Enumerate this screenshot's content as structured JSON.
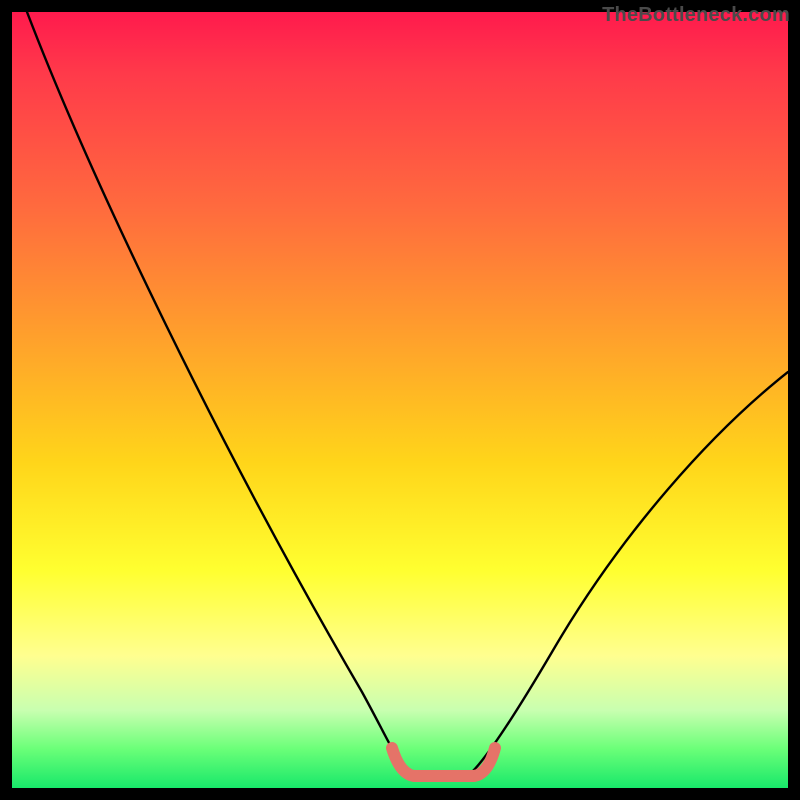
{
  "watermark": {
    "text": "TheBottleneck.com"
  },
  "chart_data": {
    "type": "line",
    "title": "",
    "xlabel": "",
    "ylabel": "",
    "x_range": [
      0,
      100
    ],
    "y_range": [
      0,
      100
    ],
    "grid": false,
    "legend": false,
    "background_gradient": {
      "direction": "vertical",
      "stops": [
        {
          "pos": 0.0,
          "color": "#ff1a4d"
        },
        {
          "pos": 0.25,
          "color": "#ff6a3e"
        },
        {
          "pos": 0.58,
          "color": "#ffd51a"
        },
        {
          "pos": 0.83,
          "color": "#ffff90"
        },
        {
          "pos": 1.0,
          "color": "#18e86a"
        }
      ]
    },
    "series": [
      {
        "name": "bottleneck-curve",
        "color": "#000000",
        "x": [
          2,
          10,
          20,
          30,
          40,
          46,
          50,
          54,
          58,
          62,
          70,
          80,
          90,
          100
        ],
        "y": [
          100,
          82,
          62,
          43,
          25,
          12,
          4,
          0,
          0,
          4,
          16,
          32,
          48,
          58
        ]
      }
    ],
    "annotations": [
      {
        "name": "optimal-range-marker",
        "type": "segment",
        "color": "#e57368",
        "points": [
          {
            "x": 48,
            "y": 4
          },
          {
            "x": 50,
            "y": 0.5
          },
          {
            "x": 60,
            "y": 0.5
          },
          {
            "x": 62,
            "y": 4
          }
        ]
      }
    ]
  }
}
